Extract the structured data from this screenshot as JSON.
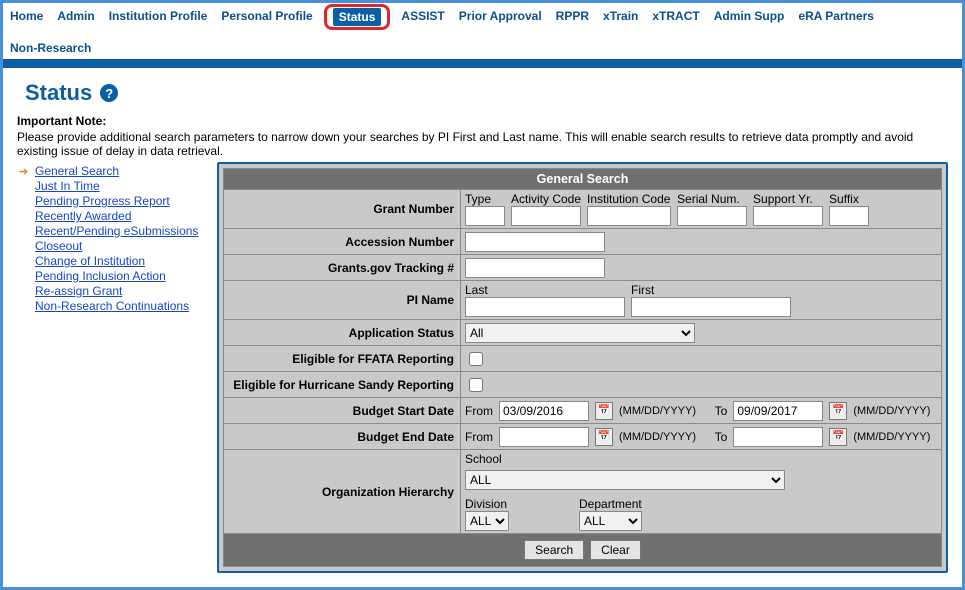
{
  "nav": {
    "items": [
      {
        "label": "Home"
      },
      {
        "label": "Admin"
      },
      {
        "label": "Institution Profile"
      },
      {
        "label": "Personal Profile"
      },
      {
        "label": "Status",
        "active": true
      },
      {
        "label": "ASSIST"
      },
      {
        "label": "Prior Approval"
      },
      {
        "label": "RPPR"
      },
      {
        "label": "xTrain"
      },
      {
        "label": "xTRACT"
      },
      {
        "label": "Admin Supp"
      },
      {
        "label": "eRA Partners"
      },
      {
        "label": "Non-Research"
      }
    ]
  },
  "page_title": "Status",
  "note": {
    "title": "Important Note:",
    "body": "Please provide additional search parameters to narrow down your searches by PI First and Last name. This will enable search results to retrieve data promptly and avoid existing issue of delay in data retrieval."
  },
  "sidebar": {
    "items": [
      {
        "label": "General Search",
        "active": true
      },
      {
        "label": "Just In Time"
      },
      {
        "label": "Pending Progress Report"
      },
      {
        "label": "Recently Awarded"
      },
      {
        "label": "Recent/Pending eSubmissions"
      },
      {
        "label": "Closeout"
      },
      {
        "label": "Change of Institution"
      },
      {
        "label": "Pending Inclusion Action"
      },
      {
        "label": "Re-assign Grant"
      },
      {
        "label": "Non-Research Continuations"
      }
    ]
  },
  "panel": {
    "title": "General Search",
    "labels": {
      "grant_number": "Grant Number",
      "accession": "Accession Number",
      "tracking": "Grants.gov Tracking #",
      "pi_name": "PI Name",
      "app_status": "Application Status",
      "ffata": "Eligible for FFATA Reporting",
      "hurricane": "Eligible for Hurricane Sandy Reporting",
      "budget_start": "Budget Start Date",
      "budget_end": "Budget End Date",
      "org": "Organization Hierarchy"
    },
    "grant_cols": {
      "type": "Type",
      "activity": "Activity Code",
      "institution": "Institution Code",
      "serial": "Serial Num.",
      "support": "Support Yr.",
      "suffix": "Suffix"
    },
    "pi": {
      "last_label": "Last",
      "first_label": "First"
    },
    "app_status_value": "All",
    "date_from": "From",
    "date_to": "To",
    "date_hint": "(MM/DD/YYYY)",
    "budget_start_from": "03/09/2016",
    "budget_start_to": "09/09/2017",
    "budget_end_from": "",
    "budget_end_to": "",
    "org": {
      "school_label": "School",
      "school_value": "ALL",
      "division_label": "Division",
      "division_value": "ALL",
      "department_label": "Department",
      "department_value": "ALL"
    },
    "buttons": {
      "search": "Search",
      "clear": "Clear"
    }
  }
}
